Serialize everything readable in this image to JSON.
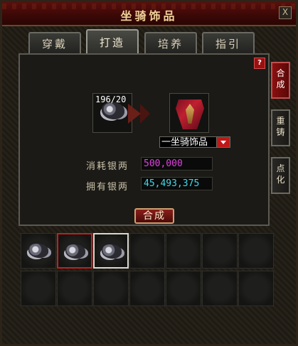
{
  "window": {
    "title": "坐骑饰品",
    "close_label": "X"
  },
  "tabs": [
    {
      "label": "穿戴",
      "active": false
    },
    {
      "label": "打造",
      "active": true
    },
    {
      "label": "培养",
      "active": false
    },
    {
      "label": "指引",
      "active": false
    }
  ],
  "help_label": "?",
  "material_slot": {
    "count": "196/20",
    "icon": "silver-ore-icon"
  },
  "result_slot": {
    "icon": "mount-ornament-icon"
  },
  "result_select": {
    "selected": "一坐骑饰品"
  },
  "fields": {
    "cost_label": "消耗银两",
    "cost_value": "500,000",
    "owned_label": "拥有银两",
    "owned_value": "45,493,375"
  },
  "compose_button": "合成",
  "side_tabs": [
    {
      "chars": [
        "合",
        "成"
      ],
      "active": true
    },
    {
      "chars": [
        "重",
        "铸"
      ],
      "active": false
    },
    {
      "chars": [
        "点",
        "化"
      ],
      "active": false
    }
  ],
  "inventory": {
    "filled": 3,
    "selected_index": 1,
    "hover_index": 2,
    "icon": "silver-ore-icon"
  },
  "colors": {
    "cost_value": "#e040e0",
    "owned_value": "#40d8e8",
    "accent_red": "#c01818"
  }
}
